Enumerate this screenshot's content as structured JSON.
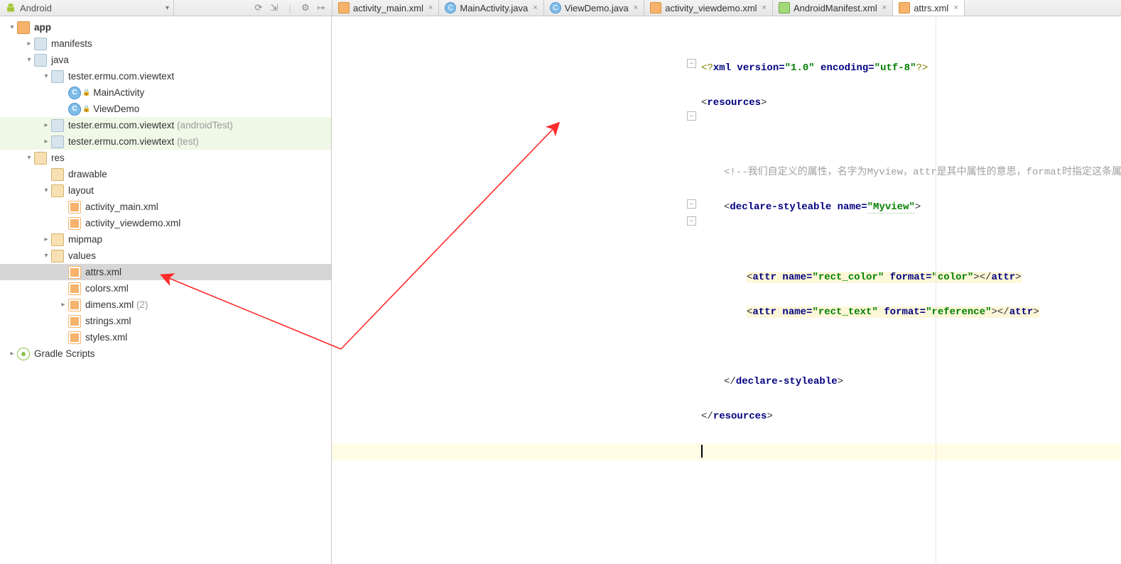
{
  "module_selector": {
    "label": "Android"
  },
  "toolbar_icons": [
    "sync-icon",
    "collapse-icon",
    "gear-icon",
    "pin-icon"
  ],
  "tabs": [
    {
      "icon": "xml",
      "label": "activity_main.xml",
      "active": false
    },
    {
      "icon": "java",
      "label": "MainActivity.java",
      "active": false
    },
    {
      "icon": "java",
      "label": "ViewDemo.java",
      "active": false
    },
    {
      "icon": "xml",
      "label": "activity_viewdemo.xml",
      "active": false
    },
    {
      "icon": "manifest",
      "label": "AndroidManifest.xml",
      "active": false
    },
    {
      "icon": "xml",
      "label": "attrs.xml",
      "active": true
    }
  ],
  "tree": {
    "app": "app",
    "manifests": "manifests",
    "java": "java",
    "pkg_main": "tester.ermu.com.viewtext",
    "cls_main": "MainActivity",
    "cls_demo": "ViewDemo",
    "pkg_android_test": "tester.ermu.com.viewtext",
    "pkg_android_test_suffix": " (androidTest)",
    "pkg_test": "tester.ermu.com.viewtext",
    "pkg_test_suffix": " (test)",
    "res": "res",
    "drawable": "drawable",
    "layout": "layout",
    "layout_file1": "activity_main.xml",
    "layout_file2": "activity_viewdemo.xml",
    "mipmap": "mipmap",
    "values": "values",
    "values_attrs": "attrs.xml",
    "values_colors": "colors.xml",
    "values_dimens": "dimens.xml",
    "values_dimens_suffix": " (2)",
    "values_strings": "strings.xml",
    "values_styles": "styles.xml",
    "gradle": "Gradle Scripts"
  },
  "code": {
    "l1_a": "<?",
    "l1_b": "xml version=",
    "l1_c": "\"1.0\"",
    "l1_d": " encoding=",
    "l1_e": "\"utf-8\"",
    "l1_f": "?>",
    "l2_a": "<",
    "l2_b": "resources",
    "l2_c": ">",
    "l4_comment": "<!--我们自定义的属性，名字为Myview，attr是其中属性的意思，format时指定这条属性是属于什么类型-->",
    "l5_a": "<",
    "l5_b": "declare-styleable ",
    "l5_c": "name=",
    "l5_d": "\"Myview\"",
    "l5_e": ">",
    "l7_a": "<",
    "l7_b": "attr ",
    "l7_c": "name=",
    "l7_d": "\"rect_color\"",
    "l7_e": " format=",
    "l7_f": "\"color\"",
    "l7_g": "></",
    "l7_h": "attr",
    "l7_i": ">",
    "l8_a": "<",
    "l8_b": "attr ",
    "l8_c": "name=",
    "l8_d": "\"rect_text\"",
    "l8_e": " format=",
    "l8_f": "\"reference\"",
    "l8_g": "></",
    "l8_h": "attr",
    "l8_i": ">",
    "l10_a": "</",
    "l10_b": "declare-styleable",
    "l10_c": ">",
    "l11_a": "</",
    "l11_b": "resources",
    "l11_c": ">"
  }
}
